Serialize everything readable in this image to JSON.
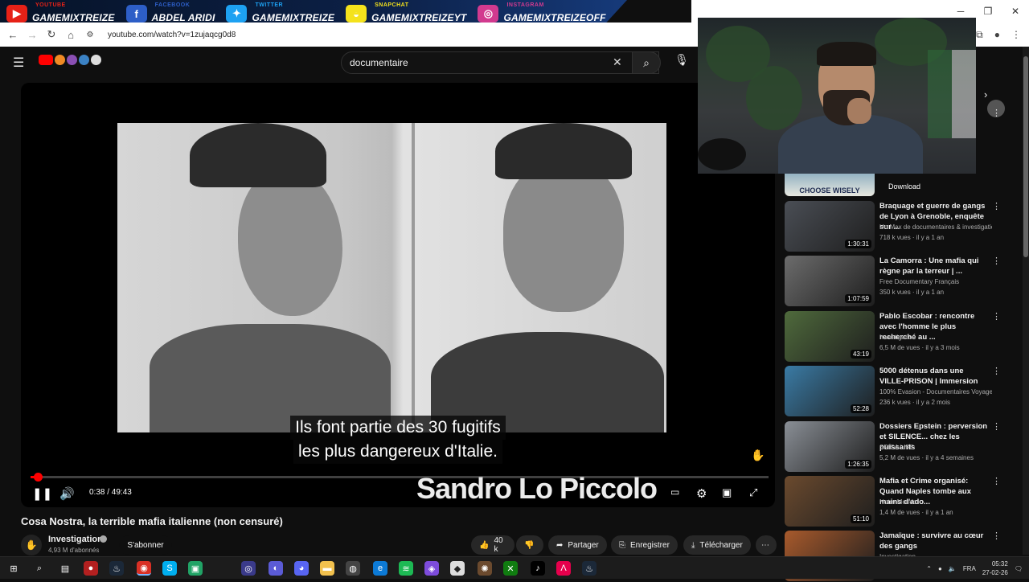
{
  "banner": {
    "socials": [
      {
        "top": "YOUTUBE",
        "name": "GAMEMIXTREIZE",
        "icon": "youtube-icon",
        "color": "#e62117",
        "glyph": "▶"
      },
      {
        "top": "FACEBOOK",
        "name": "ABDEL ARIDI",
        "icon": "facebook-icon",
        "color": "#2d5ec7",
        "glyph": "f"
      },
      {
        "top": "TWITTER",
        "name": "GAMEMIXTREIZE",
        "icon": "twitter-icon",
        "color": "#1da1f2",
        "glyph": "✦"
      },
      {
        "top": "SNAPCHAT",
        "name": "GAMEMIXTREIZEYT",
        "icon": "snapchat-icon",
        "color": "#f4e21c",
        "glyph": "◒"
      },
      {
        "top": "INSTAGRAM",
        "name": "GAMEMIXTREIZEOFF",
        "icon": "instagram-icon",
        "color": "#d23a8f",
        "glyph": "◎"
      }
    ]
  },
  "browser": {
    "url": "youtube.com/watch?v=1zujaqcg0d8"
  },
  "header": {
    "search_value": "documentaire"
  },
  "player": {
    "subtitle_line1": "Ils font partie des 30 fugitifs",
    "subtitle_line2": "les plus dangereux d'Italie.",
    "lower_third": "Sandro Lo Piccolo",
    "time_current": "0:38",
    "time_total": "49:43",
    "timecode": "0:38 / 49:43",
    "progress": 0.013,
    "accent": "#ff0000"
  },
  "video": {
    "title": "Cosa Nostra, la terrible mafia italienne (non censuré)",
    "channel": "Investigation",
    "subscribers": "4,93 M d'abonnés",
    "subscribe_label": "S'abonner",
    "likes": "40 k",
    "share_label": "Partager",
    "save_label": "Enregistrer",
    "download_label": "Télécharger"
  },
  "sidebar": {
    "ad_thumb_text": "CHOOSE WISELY",
    "download_chip": "Download",
    "recommendations": [
      {
        "title": "Braquage et guerre de gangs de Lyon à Grenoble, enquête sur ...",
        "channel": "Un Max de documentaires & investigatio...",
        "meta": "718 k vues · il y a 1 an",
        "duration": "1:30:31",
        "thumb_color": "#4a4e55"
      },
      {
        "title": "La Camorra : Une mafia qui règne par la terreur | ...",
        "channel": "Free Documentary Français",
        "meta": "350 k vues · il y a 1 an",
        "duration": "1:07:59",
        "thumb_color": "#6c6c6c"
      },
      {
        "title": "Pablo Escobar : rencontre avec l'homme le plus recherché au ...",
        "channel": "Investigation",
        "meta": "6,5 M de vues · il y a 3 mois",
        "duration": "43:19",
        "thumb_color": "#4f6a3c"
      },
      {
        "title": "5000 détenus dans une VILLE-PRISON | Immersion",
        "channel": "100% Evasion - Documentaires Voyages",
        "meta": "236 k vues · il y a 2 mois",
        "duration": "52:28",
        "thumb_color": "#3a7ba5"
      },
      {
        "title": "Dossiers Epstein : perversion et SILENCE... chez les puissants",
        "channel": "SPICA LIFE",
        "meta": "5,2 M de vues · il y a 4 semaines",
        "duration": "1:26:35",
        "thumb_color": "#8a8f96"
      },
      {
        "title": "Mafia et Crime organisé: Quand Naples tombe aux mains d'ado...",
        "channel": "Notre Monde",
        "meta": "1,4 M de vues · il y a 1 an",
        "duration": "51:10",
        "thumb_color": "#6b4a2e"
      },
      {
        "title": "Jamaïque : survivre au cœur des gangs",
        "channel": "Investigation",
        "meta": "",
        "duration": "",
        "thumb_color": "#a85a2c"
      }
    ]
  },
  "taskbar": {
    "lang": "FRA",
    "time": "05:32",
    "date": "27-02-26"
  }
}
